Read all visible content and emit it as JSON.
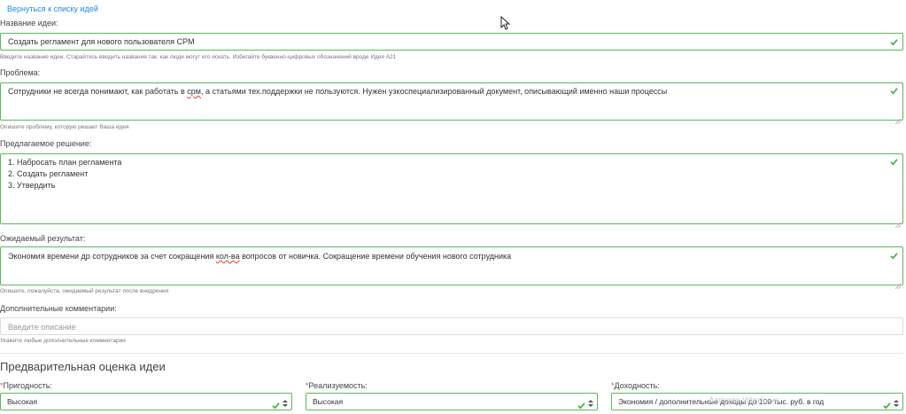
{
  "back_link": "Вернуться к списку идей",
  "name": {
    "label": "Название идеи:",
    "value": "Создать регламент для нового пользователя CPM",
    "hint": "Введите название идеи. Старайтесь вводить названия так, как люди могут его искать. Избегайте буквенно-цифровых обозначений вроде Идея A21"
  },
  "problem": {
    "label": "Проблема:",
    "value_part1": "Сотрудники не всегда понимают, как работать в ",
    "value_misspelled": "срм",
    "value_part2": ", а статьями тех.поддержки не пользуются. Нужен узкоспециализированный документ, описывающий именно наши процессы",
    "hint": "Опишите проблему, которую решает Ваша идея"
  },
  "solution": {
    "label": "Предлагаемое решение:",
    "lines": [
      "1. Набросать план регламента",
      "2. Создать регламент",
      "3. Утвердить"
    ]
  },
  "result": {
    "label": "Ожидаемый результат:",
    "value_part1": "Экономия времени др сотрудников за счет сокращения ",
    "value_misspelled": "кол-ва",
    "value_part2": " вопросов от новичка. Сокращение времени обучения нового сотрудника",
    "hint": "Опишите, пожалуйста, ожидаемый результат после внедрения"
  },
  "comments": {
    "label": "Дополнительные комментарии:",
    "placeholder": "Введите описание",
    "hint": "Укажите любые дополнительные комментарии"
  },
  "assessment": {
    "title": "Предварительная оценка идеи",
    "required_mark": "*",
    "suitability": {
      "label": "Пригодность:",
      "value": "Высокая"
    },
    "feasibility": {
      "label": "Реализуемость:",
      "value": "Высокая"
    },
    "profitability": {
      "label": "Доходность:",
      "value": "Экономия / дополнительные доходы до 100 тыс. руб. в год"
    }
  },
  "watermark": "Activate Windows",
  "colors": {
    "valid_border": "#5cb85c",
    "link": "#1e88e5",
    "required": "#d9534f"
  }
}
